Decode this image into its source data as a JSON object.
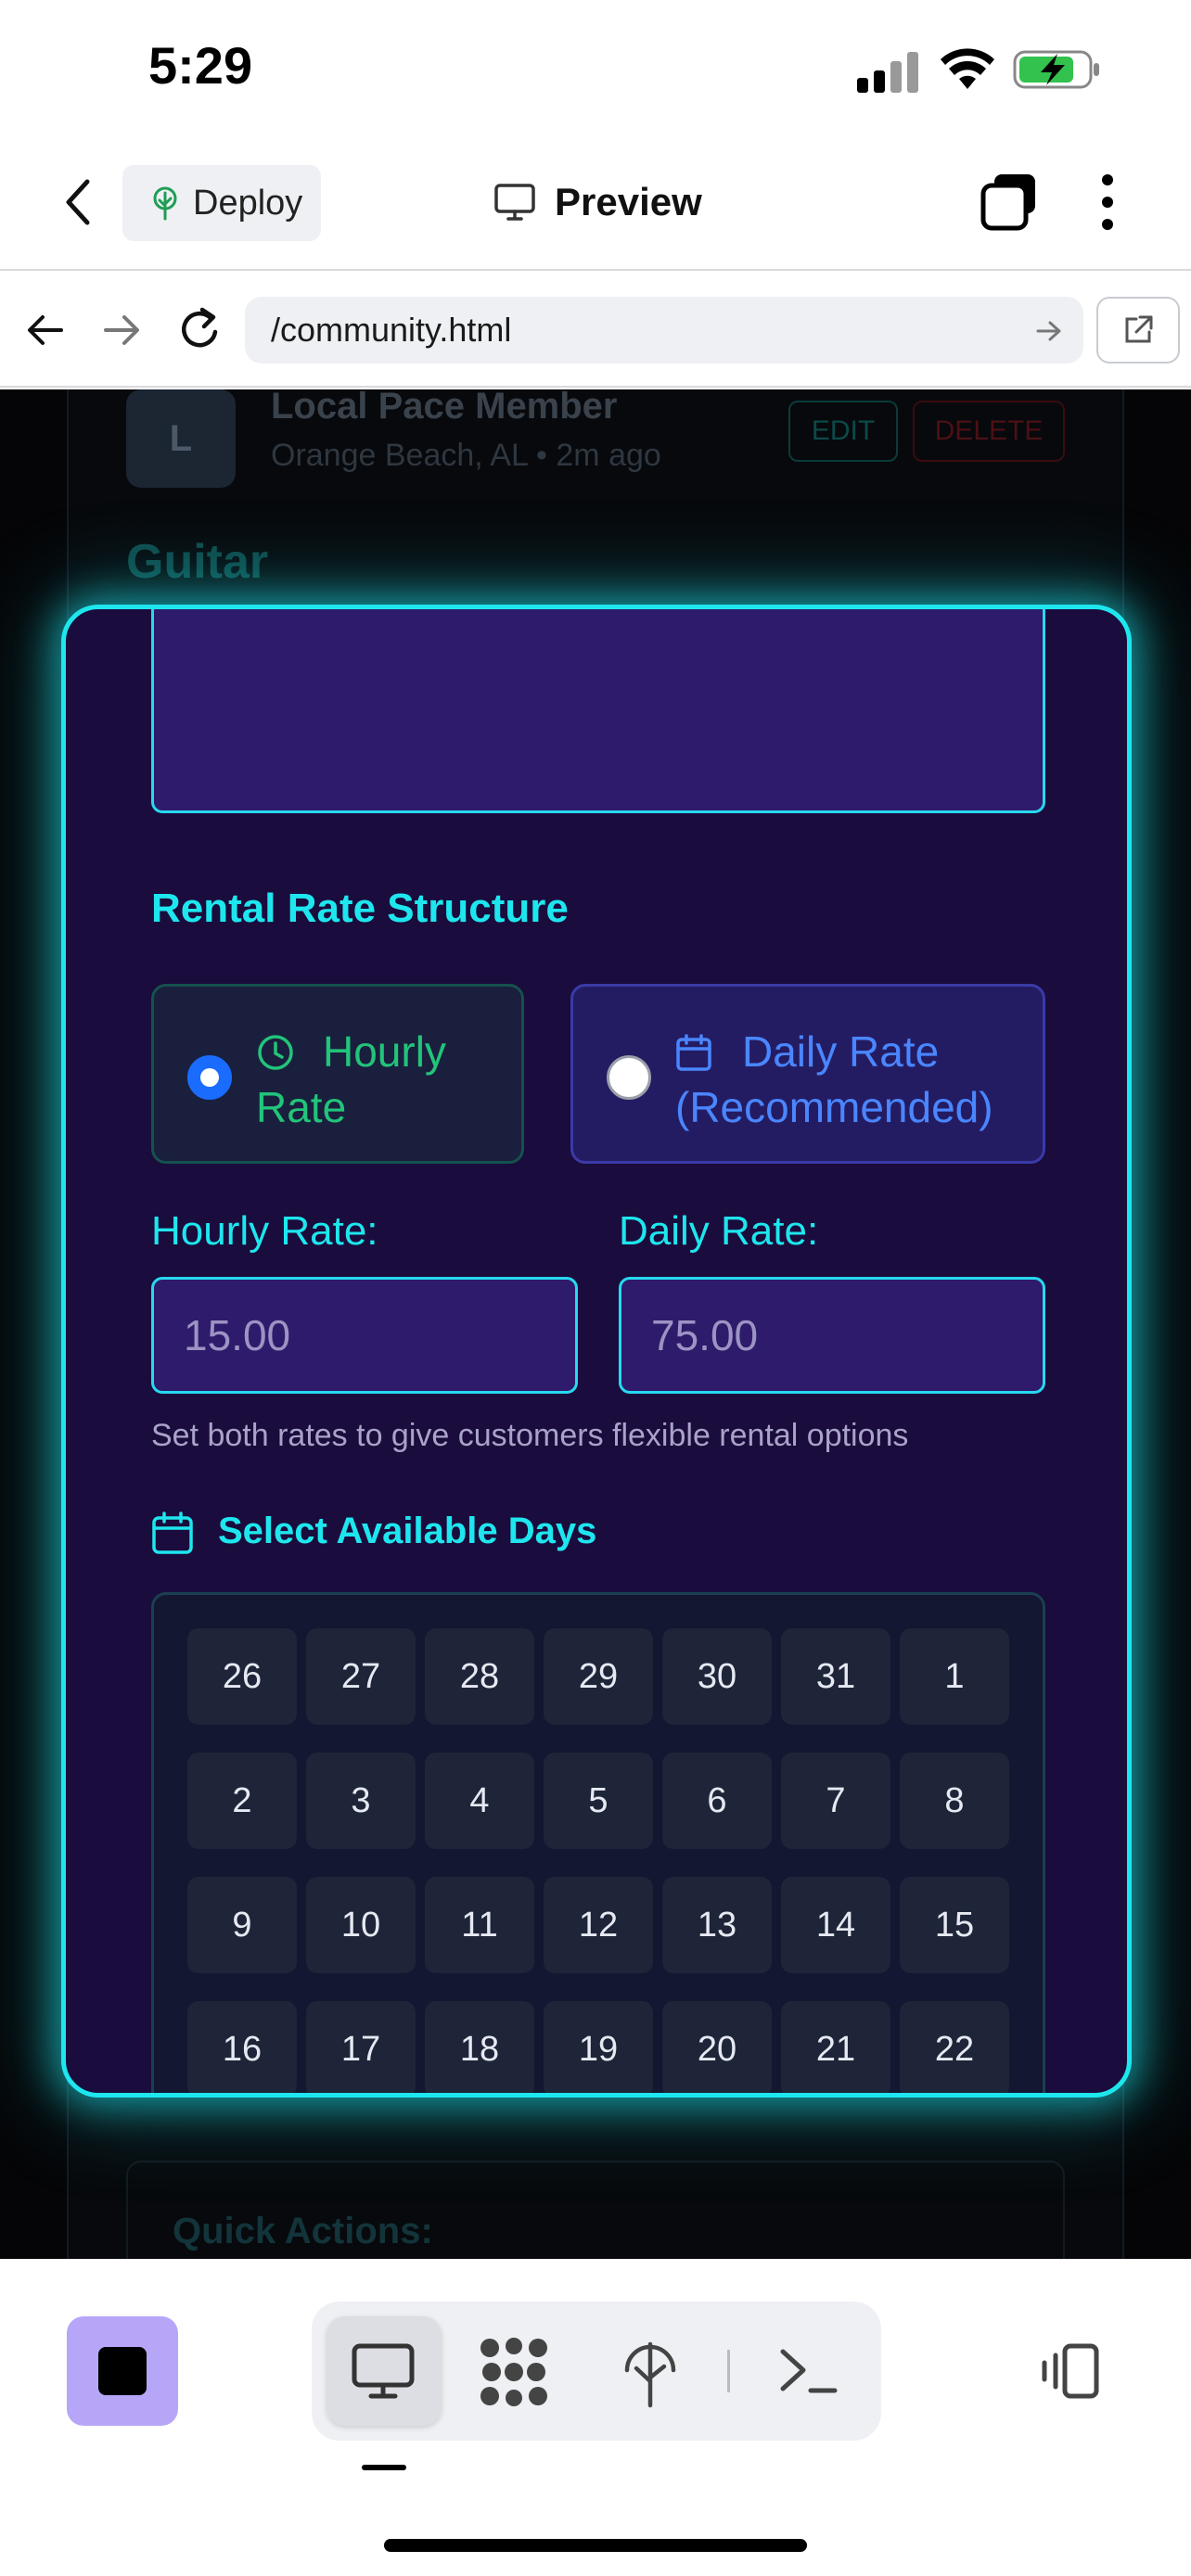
{
  "status_bar": {
    "time": "5:29"
  },
  "header": {
    "deploy_label": "Deploy",
    "title": "Preview"
  },
  "browser": {
    "url": "/community.html"
  },
  "background_page": {
    "avatar_initial": "L",
    "member_name": "Local Pace Member",
    "location_time": "Orange Beach, AL • 2m ago",
    "edit_label": "EDIT",
    "delete_label": "DELETE",
    "item_title": "Guitar",
    "quick_actions": "Quick Actions:"
  },
  "modal": {
    "rate_section_title": "Rental Rate Structure",
    "hourly_option": {
      "line1": "Hourly",
      "line2": "Rate",
      "selected": true
    },
    "daily_option": {
      "line1": "Daily Rate",
      "line2": "(Recommended)",
      "selected": false
    },
    "hourly_label": "Hourly Rate:",
    "daily_label": "Daily Rate:",
    "hourly_placeholder": "15.00",
    "daily_placeholder": "75.00",
    "helper_text": "Set both rates to give customers flexible rental options",
    "days_title": "Select Available Days",
    "calendar_rows": [
      [
        "26",
        "27",
        "28",
        "29",
        "30",
        "31",
        "1"
      ],
      [
        "2",
        "3",
        "4",
        "5",
        "6",
        "7",
        "8"
      ],
      [
        "9",
        "10",
        "11",
        "12",
        "13",
        "14",
        "15"
      ],
      [
        "16",
        "17",
        "18",
        "19",
        "20",
        "21",
        "22"
      ]
    ]
  },
  "colors": {
    "accent": "#1ee6ee",
    "modal_bg": "#1a0c3c",
    "input_bg": "#2e1b6b",
    "radio_selected": "#1a6cff",
    "hourly_green": "#22c47a",
    "daily_blue": "#4a86ff"
  }
}
